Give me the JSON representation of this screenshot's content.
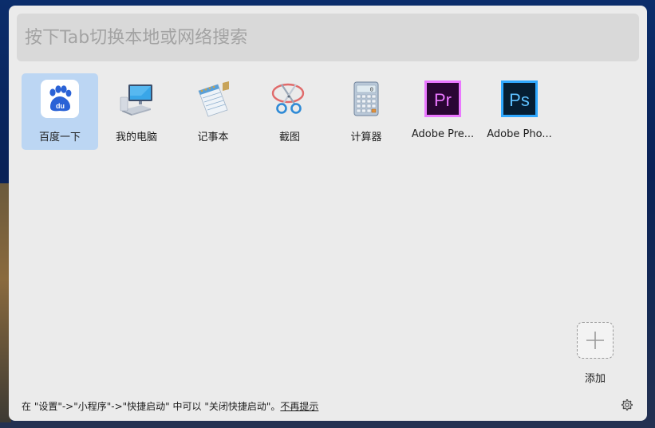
{
  "search": {
    "placeholder": "按下Tab切换本地或网络搜索"
  },
  "apps": [
    {
      "label": "百度一下",
      "icon": "baidu-icon",
      "selected": true
    },
    {
      "label": "我的电脑",
      "icon": "computer-icon"
    },
    {
      "label": "记事本",
      "icon": "notepad-icon"
    },
    {
      "label": "截图",
      "icon": "scissors-icon"
    },
    {
      "label": "计算器",
      "icon": "calculator-icon"
    },
    {
      "label": "Adobe Pre...",
      "icon": "adobe-premiere-icon"
    },
    {
      "label": "Adobe Pho...",
      "icon": "adobe-photoshop-icon"
    }
  ],
  "add": {
    "label": "添加",
    "icon": "plus-icon"
  },
  "footer": {
    "text": "在 \"设置\"->\"小程序\"->\"快捷启动\" 中可以 \"关闭快捷启动\"。",
    "link": "不再提示",
    "settings_icon": "gear-icon"
  },
  "colors": {
    "panel": "#ebebeb",
    "search_bg": "#d9d9d9",
    "selected": "#bcd6f3"
  }
}
